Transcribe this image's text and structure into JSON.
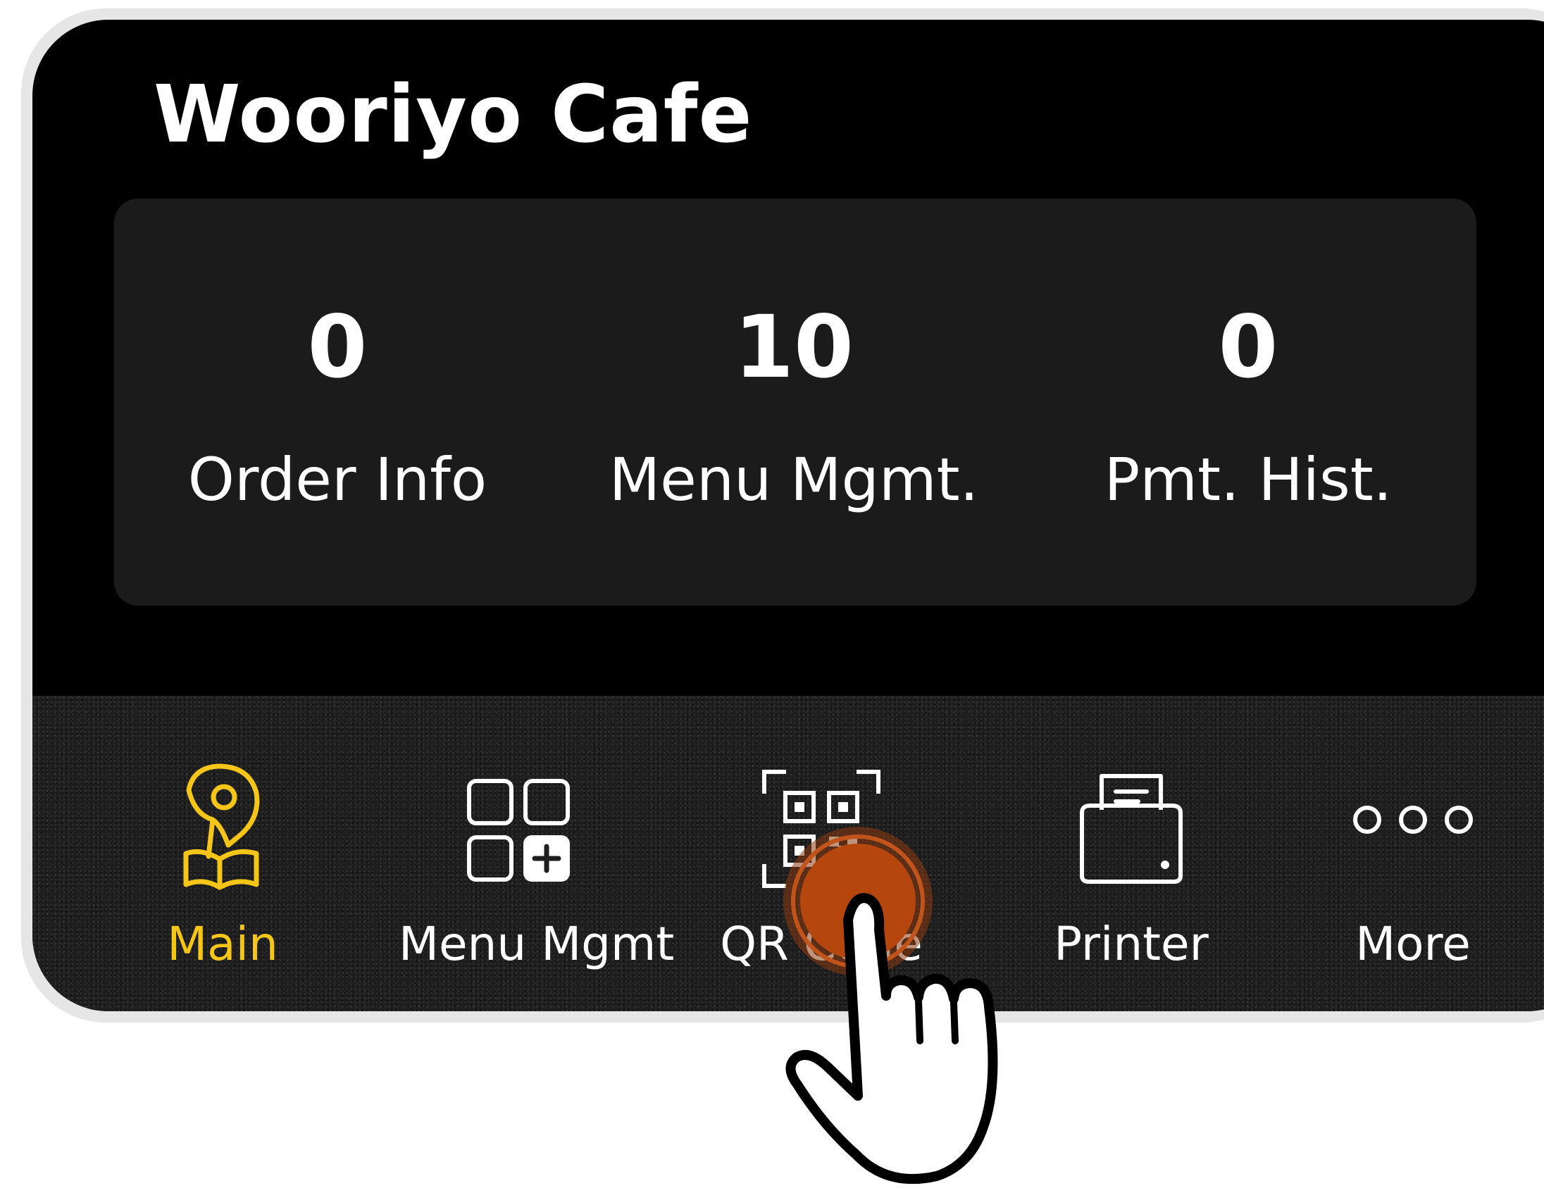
{
  "app": {
    "title": "Wooriyo Cafe"
  },
  "stats": [
    {
      "value": "0",
      "label": "Order Info"
    },
    {
      "value": "10",
      "label": "Menu Mgmt."
    },
    {
      "value": "0",
      "label": "Pmt. Hist."
    }
  ],
  "tabbar": {
    "active": "Main",
    "active_color": "#f5c518",
    "tabs": [
      {
        "label": "Main",
        "icon": "map-pin-book-icon"
      },
      {
        "label": "Menu Mgmt",
        "icon": "grid-add-icon"
      },
      {
        "label": "QR Code",
        "icon": "qr-code-icon"
      },
      {
        "label": "Printer",
        "icon": "printer-icon"
      },
      {
        "label": "More",
        "icon": "more-dots-icon"
      }
    ]
  },
  "overlay": {
    "hint_icon": "tap-hand-icon",
    "hint_color": "#b5470e"
  }
}
